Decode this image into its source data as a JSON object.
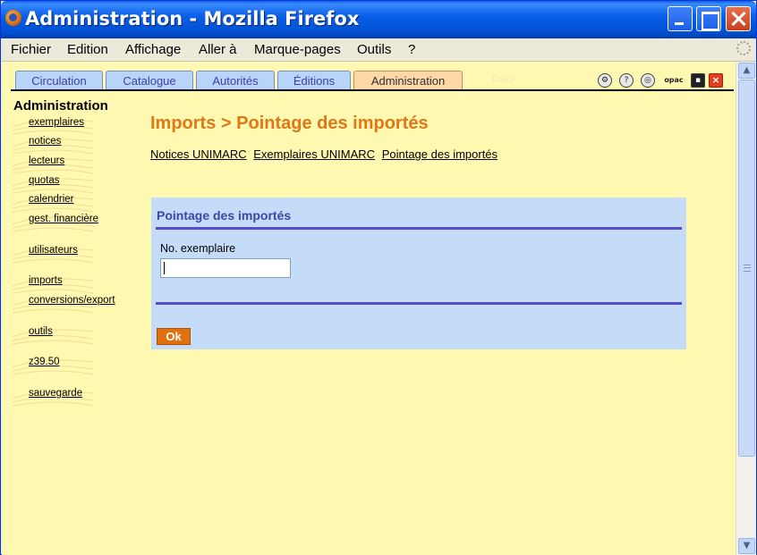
{
  "window": {
    "title": "Administration - Mozilla Firefox"
  },
  "menubar": {
    "items": [
      {
        "label": "Fichier"
      },
      {
        "label": "Edition"
      },
      {
        "label": "Affichage"
      },
      {
        "label": "Aller à"
      },
      {
        "label": "Marque-pages"
      },
      {
        "label": "Outils"
      },
      {
        "label": "?"
      }
    ]
  },
  "tabs": {
    "items": [
      {
        "label": "Circulation"
      },
      {
        "label": "Catalogue"
      },
      {
        "label": "Autorités"
      },
      {
        "label": "Éditions"
      },
      {
        "label": "Administration"
      }
    ],
    "active": "Administration",
    "ghost_label": "DSO",
    "tool_icons": [
      "tools-icon",
      "help-icon",
      "settings-icon",
      "opac-icon",
      "save-icon",
      "quit-icon"
    ],
    "opac_label": "opac"
  },
  "sidebar": {
    "title": "Administration",
    "items": [
      {
        "label": "exemplaires"
      },
      {
        "label": "notices"
      },
      {
        "label": "lecteurs"
      },
      {
        "label": "quotas"
      },
      {
        "label": "calendrier"
      },
      {
        "label": "gest. financière"
      },
      {
        "label": "utilisateurs"
      },
      {
        "label": "imports"
      },
      {
        "label": "conversions/export"
      },
      {
        "label": "outils"
      },
      {
        "label": "z39.50"
      },
      {
        "label": "sauvegarde"
      }
    ]
  },
  "main": {
    "title": "Imports > Pointage des importés",
    "sublinks": [
      {
        "label": "Notices UNIMARC"
      },
      {
        "label": "Exemplaires UNIMARC"
      },
      {
        "label": "Pointage des importés"
      }
    ],
    "form": {
      "title": "Pointage des importés",
      "field_label": "No. exemplaire",
      "field_value": "",
      "submit_label": "Ok"
    }
  },
  "colors": {
    "page_background": "#fff8b0",
    "title_orange": "#e07818",
    "form_background": "#c4dcf8",
    "form_rule": "#5a4cc8",
    "ok_button": "#e07010",
    "tab_inactive": "#b8d4f8",
    "tab_active": "#ffd8a8"
  }
}
